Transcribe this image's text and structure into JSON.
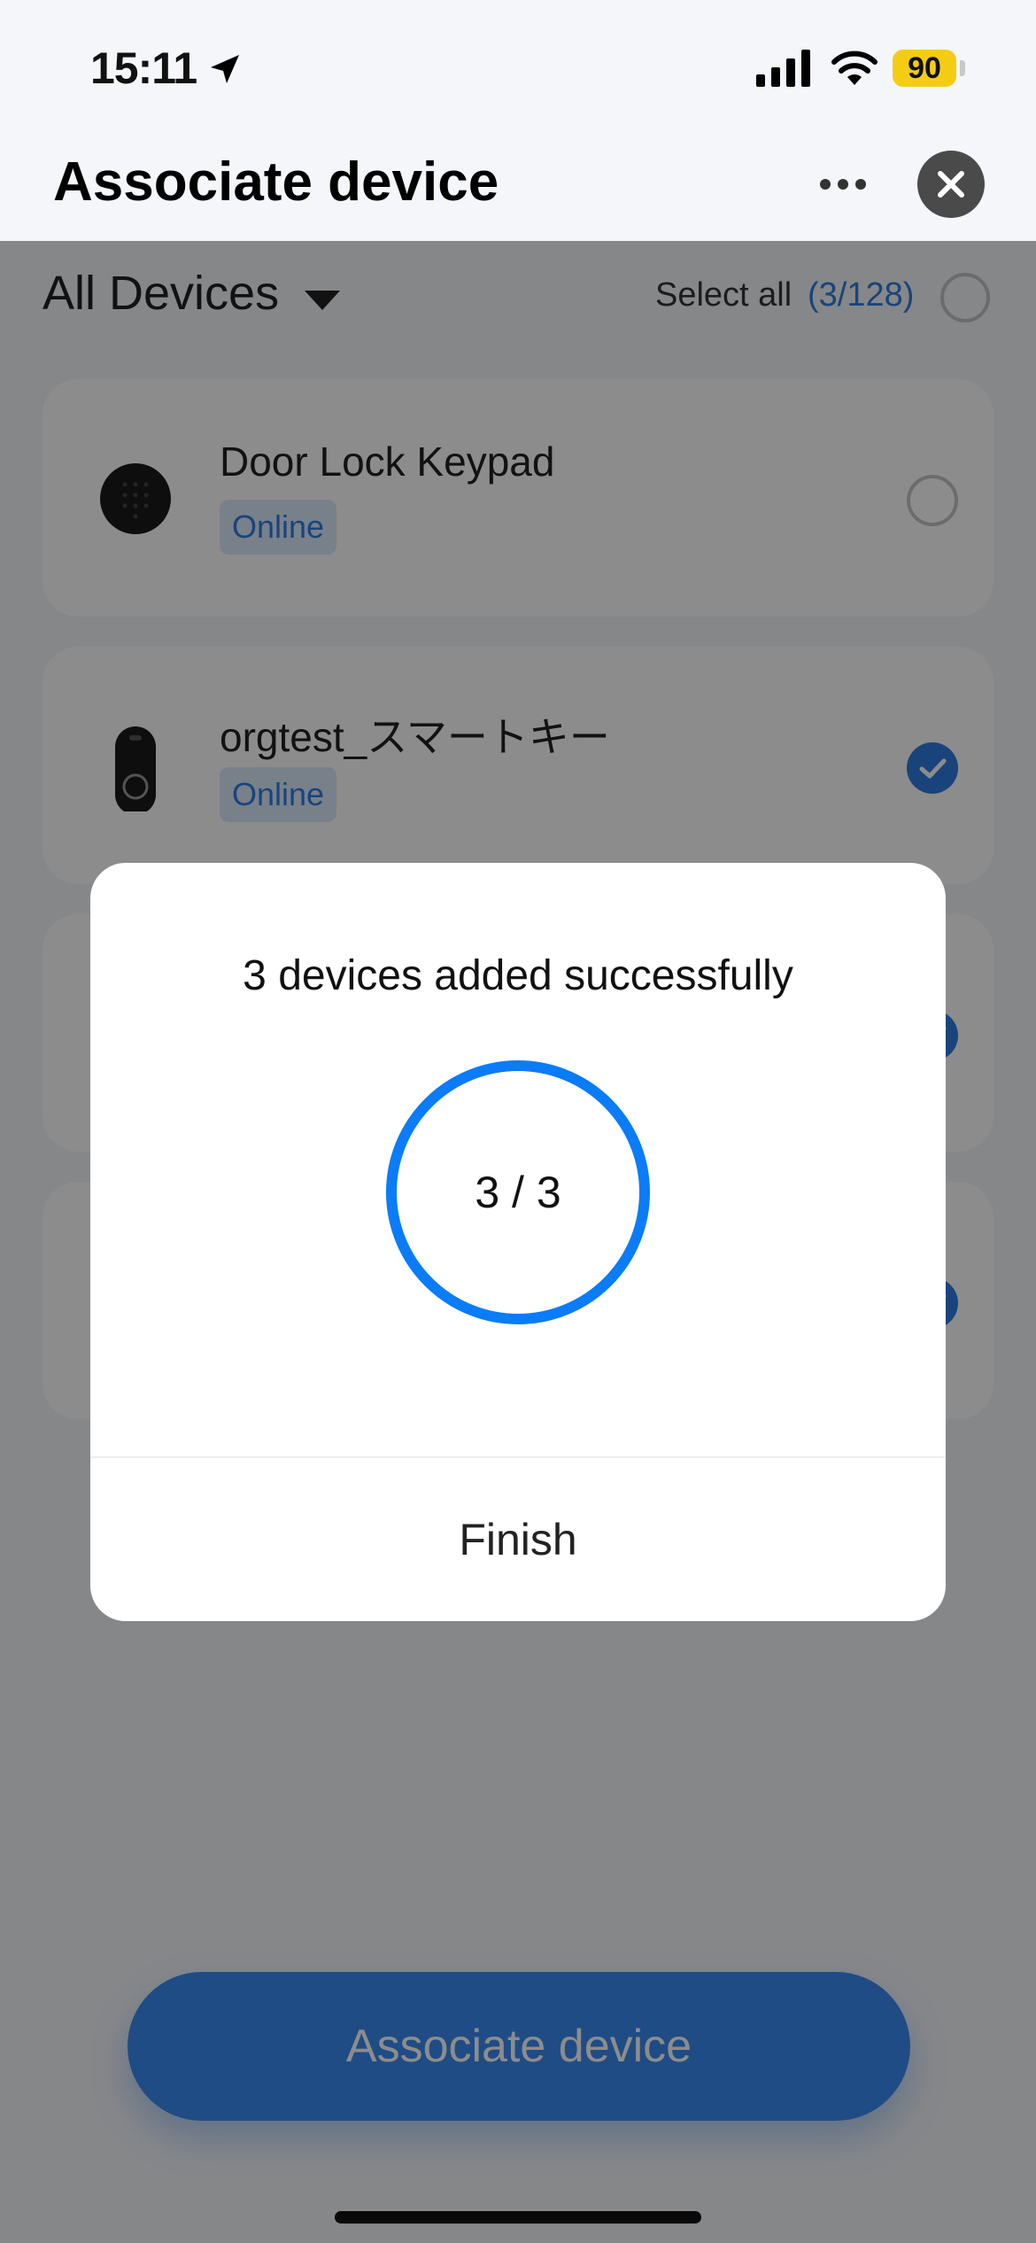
{
  "status_bar": {
    "time": "15:11",
    "battery": "90"
  },
  "header": {
    "title": "Associate device"
  },
  "filter": {
    "label": "All Devices",
    "select_all_label": "Select all",
    "select_count": "(3/128)"
  },
  "devices": [
    {
      "name": "Door Lock Keypad",
      "status": "Online",
      "selected": false
    },
    {
      "name": "orgtest_スマートキー",
      "status": "Online",
      "selected": true
    },
    {
      "name": "",
      "status": "",
      "selected": true
    },
    {
      "name": "",
      "status": "",
      "selected": true
    }
  ],
  "footer": {
    "button_label": "Associate device"
  },
  "modal": {
    "title": "3 devices added successfully",
    "progress_text": "3 / 3",
    "progress_fraction": 1.0,
    "finish_label": "Finish"
  },
  "colors": {
    "accent": "#2f7de1",
    "progress_ring": "#0a7cf7",
    "overlay": "rgba(0,0,0,0.45)"
  }
}
